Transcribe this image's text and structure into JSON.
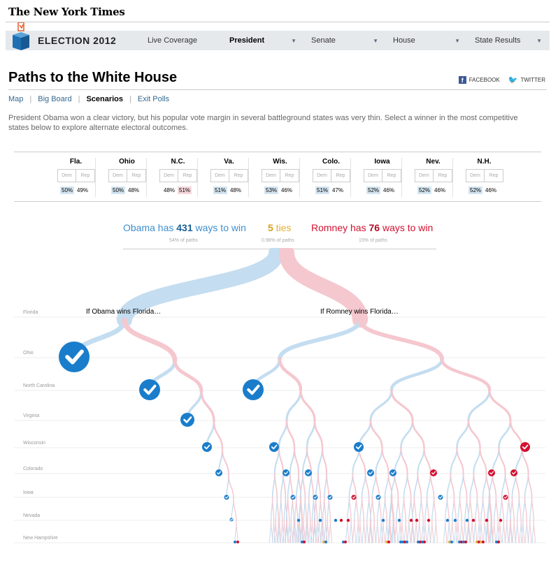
{
  "masthead": {
    "logo": "The New York Times"
  },
  "nav": {
    "brand": "ELECTION 2012",
    "tabs": [
      {
        "label": "Live Coverage",
        "dropdown": false,
        "active": false
      },
      {
        "label": "President",
        "dropdown": true,
        "active": true
      },
      {
        "label": "Senate",
        "dropdown": true,
        "active": false
      },
      {
        "label": "House",
        "dropdown": true,
        "active": false
      },
      {
        "label": "State Results",
        "dropdown": true,
        "active": false
      }
    ]
  },
  "page": {
    "title": "Paths to the White House",
    "share": {
      "facebook": "FACEBOOK",
      "twitter": "TWITTER"
    },
    "subnav": [
      "Map",
      "Big Board",
      "Scenarios",
      "Exit Polls"
    ],
    "subnav_current": "Scenarios",
    "intro": "President Obama won a clear victory, but his popular vote margin in several battleground states was very thin. Select a winner in the most competitive states below to explore alternate electoral outcomes."
  },
  "buttons": {
    "dem": "Dem",
    "rep": "Rep"
  },
  "states": [
    {
      "name": "Fla.",
      "dem": "50%",
      "rep": "49%",
      "leader": "dem"
    },
    {
      "name": "Ohio",
      "dem": "50%",
      "rep": "48%",
      "leader": "dem"
    },
    {
      "name": "N.C.",
      "dem": "48%",
      "rep": "51%",
      "leader": "rep"
    },
    {
      "name": "Va.",
      "dem": "51%",
      "rep": "48%",
      "leader": "dem"
    },
    {
      "name": "Wis.",
      "dem": "53%",
      "rep": "46%",
      "leader": "dem"
    },
    {
      "name": "Colo.",
      "dem": "51%",
      "rep": "47%",
      "leader": "dem"
    },
    {
      "name": "Iowa",
      "dem": "52%",
      "rep": "46%",
      "leader": "dem"
    },
    {
      "name": "Nev.",
      "dem": "52%",
      "rep": "46%",
      "leader": "dem"
    },
    {
      "name": "N.H.",
      "dem": "52%",
      "rep": "46%",
      "leader": "dem"
    }
  ],
  "summary": {
    "obama": {
      "prefix": "Obama has ",
      "count": "431",
      "suffix": " ways to win",
      "share": "54% of paths"
    },
    "ties": {
      "count": "5",
      "suffix": " ties",
      "share": "0.98% of paths"
    },
    "romney": {
      "prefix": "Romney has ",
      "count": "76",
      "suffix": " ways to win",
      "share": "15% of paths"
    }
  },
  "tree": {
    "rows": [
      "Florida",
      "Ohio",
      "North Carolina",
      "Virginia",
      "Wisconsin",
      "Colorado",
      "Iowa",
      "Nevada",
      "New Hampshire"
    ],
    "branch_labels": {
      "obama": "If Obama wins Florida…",
      "romney": "If Romney wins Florida…"
    },
    "colors": {
      "dem": "#c4ddf0",
      "rep": "#f5c7cf",
      "dem_dot": "#1a7dcb",
      "rep_dot": "#d2102f",
      "tie": "#e3b13b"
    }
  }
}
